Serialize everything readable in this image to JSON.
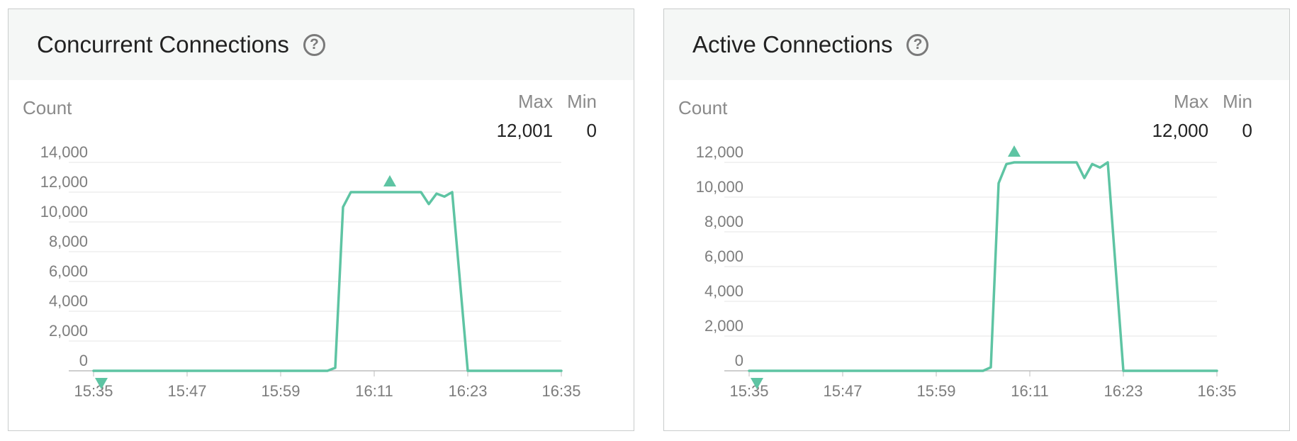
{
  "panels": [
    {
      "title": "Concurrent Connections",
      "help_icon": "question-circle-icon",
      "unit_label": "Count",
      "stats": {
        "max_label": "Max",
        "max_value": "12,001",
        "min_label": "Min",
        "min_value": "0"
      }
    },
    {
      "title": "Active Connections",
      "help_icon": "question-circle-icon",
      "unit_label": "Count",
      "stats": {
        "max_label": "Max",
        "max_value": "12,000",
        "min_label": "Min",
        "min_value": "0"
      }
    }
  ],
  "chart_data": [
    {
      "type": "line",
      "title": "Concurrent Connections",
      "ylabel": "Count",
      "ylim": [
        0,
        14000
      ],
      "y_ticks": [
        "0",
        "2,000",
        "4,000",
        "6,000",
        "8,000",
        "10,000",
        "12,000",
        "14,000"
      ],
      "x_ticks": [
        "15:35",
        "15:47",
        "15:59",
        "16:11",
        "16:23",
        "16:35"
      ],
      "grid": true,
      "color": "#5ec4a3",
      "x": [
        "15:35",
        "15:37",
        "15:39",
        "15:41",
        "15:43",
        "15:45",
        "15:47",
        "15:49",
        "15:51",
        "15:53",
        "15:55",
        "15:57",
        "15:59",
        "16:01",
        "16:03",
        "16:05",
        "16:06",
        "16:07",
        "16:08",
        "16:09",
        "16:10",
        "16:11",
        "16:12",
        "16:13",
        "16:14",
        "16:15",
        "16:16",
        "16:17",
        "16:18",
        "16:19",
        "16:20",
        "16:21",
        "16:23",
        "16:25",
        "16:27",
        "16:29",
        "16:31",
        "16:33",
        "16:35"
      ],
      "y": [
        0,
        0,
        0,
        0,
        0,
        0,
        0,
        0,
        0,
        0,
        0,
        0,
        0,
        0,
        0,
        0,
        200,
        11000,
        12000,
        12001,
        12000,
        12000,
        12000,
        12000,
        12000,
        12000,
        12000,
        12000,
        11200,
        11900,
        11700,
        12000,
        0,
        0,
        0,
        0,
        0,
        0,
        0
      ],
      "max_marker": {
        "x": "16:13",
        "label": "max"
      },
      "min_marker": {
        "x": "15:36",
        "label": "min"
      }
    },
    {
      "type": "line",
      "title": "Active Connections",
      "ylabel": "Count",
      "ylim": [
        0,
        12500
      ],
      "y_ticks": [
        "0",
        "2,000",
        "4,000",
        "6,000",
        "8,000",
        "10,000",
        "12,000"
      ],
      "x_ticks": [
        "15:35",
        "15:47",
        "15:59",
        "16:11",
        "16:23",
        "16:35"
      ],
      "grid": true,
      "color": "#5ec4a3",
      "x": [
        "15:35",
        "15:37",
        "15:39",
        "15:41",
        "15:43",
        "15:45",
        "15:47",
        "15:49",
        "15:51",
        "15:53",
        "15:55",
        "15:57",
        "15:59",
        "16:01",
        "16:03",
        "16:05",
        "16:06",
        "16:07",
        "16:08",
        "16:09",
        "16:10",
        "16:11",
        "16:12",
        "16:13",
        "16:14",
        "16:15",
        "16:16",
        "16:17",
        "16:18",
        "16:19",
        "16:20",
        "16:21",
        "16:23",
        "16:25",
        "16:27",
        "16:29",
        "16:31",
        "16:33",
        "16:35"
      ],
      "y": [
        0,
        0,
        0,
        0,
        0,
        0,
        0,
        0,
        0,
        0,
        0,
        0,
        0,
        0,
        0,
        0,
        200,
        10800,
        11900,
        12000,
        12000,
        12000,
        12000,
        12000,
        12000,
        12000,
        12000,
        12000,
        11100,
        11900,
        11700,
        12000,
        0,
        0,
        0,
        0,
        0,
        0,
        0
      ],
      "max_marker": {
        "x": "16:09",
        "label": "max"
      },
      "min_marker": {
        "x": "15:36",
        "label": "min"
      }
    }
  ]
}
